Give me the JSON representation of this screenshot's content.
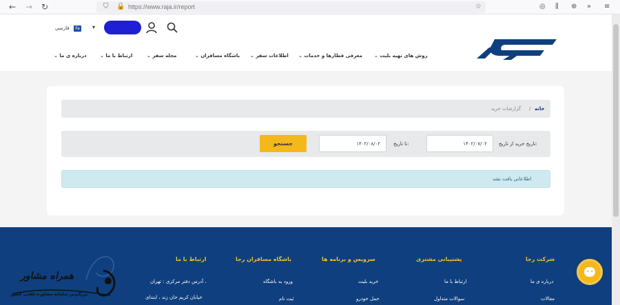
{
  "browser": {
    "url": "https://www.raja.ir/report"
  },
  "header": {
    "lang_badge": "Fa",
    "lang_label": "فارسی",
    "menu": [
      "روش های تهیه بلیت",
      "معرفی قطارها و خدمات",
      "اطلاعات سفر",
      "باشگاه مسافران",
      "مجله سفر",
      "ارتباط با ما",
      "درباره ی ما"
    ]
  },
  "breadcrumb": {
    "home": "خانه",
    "separator": "/",
    "current": "گزارشات خرید"
  },
  "filters": {
    "from_label": "تاریخ خرید از تاریخ:",
    "from_value": "۱۴۰۲/۰۷/۰۲",
    "to_label": "تا تاریخ:",
    "to_value": "۱۴۰۲/۰۸/۰۲",
    "search_label": "جستجو"
  },
  "alert": {
    "message": "اطلاعاتی یافت نشد"
  },
  "footer": {
    "col_company": {
      "title": "شرکت رجا",
      "links": [
        "درباره ی ما",
        "مقالات"
      ]
    },
    "col_support": {
      "title": "پشتیبانی مشتری",
      "links": [
        "ارتباط با ما",
        "سوالات متداول"
      ]
    },
    "col_services": {
      "title": "سرویس و برنامه ها",
      "links": [
        "خرید بلیت",
        "حمل خودرو"
      ]
    },
    "col_club": {
      "title": "باشگاه مسافران رجا",
      "links": [
        "ورود به باشگاه",
        "ثبت نام"
      ]
    },
    "col_contact": {
      "title": "ارتباط با ما",
      "links": [
        "آدرس دفتر مرکزی : تهران ،",
        "خیابان کریم خان زند ، ابتدای"
      ]
    }
  },
  "watermark": {
    "title": "همراه مشاور",
    "subtitle": "بزرگترین سامانه مشاوره تلفنی کشور"
  },
  "colors": {
    "accent": "#f5b81c",
    "footer_bg": "#0f3f7e",
    "brand_blue": "#1d4ea8",
    "alert_bg": "#cfe9f0"
  }
}
